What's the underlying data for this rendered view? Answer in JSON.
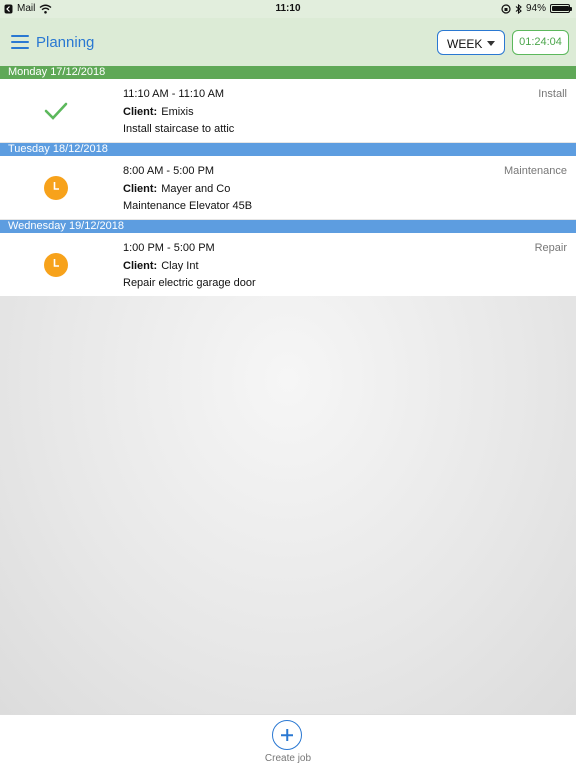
{
  "status_bar": {
    "back_app": "Mail",
    "time": "11:10",
    "battery": "94%",
    "battery_level": 0.94
  },
  "header": {
    "title": "Planning",
    "view_select": "WEEK",
    "timer": "01:24:04"
  },
  "days": [
    {
      "label": "Monday 17/12/2018",
      "color": "#5fa857",
      "jobs": [
        {
          "time": "11:10 AM - 11:10 AM",
          "type": "Install",
          "client_label": "Client:",
          "client": "Emixis",
          "description": "Install staircase to attic",
          "status_icon": "check-icon"
        }
      ]
    },
    {
      "label": "Tuesday 18/12/2018",
      "color": "#5d9de0",
      "jobs": [
        {
          "time": "8:00 AM - 5:00 PM",
          "type": "Maintenance",
          "client_label": "Client:",
          "client": "Mayer and Co",
          "description": "Maintenance Elevator 45B",
          "status_icon": "clock-icon"
        }
      ]
    },
    {
      "label": "Wednesday 19/12/2018",
      "color": "#5d9de0",
      "jobs": [
        {
          "time": "1:00 PM - 5:00 PM",
          "type": "Repair",
          "client_label": "Client:",
          "client": "Clay Int",
          "description": "Repair electric garage door",
          "status_icon": "clock-icon"
        }
      ]
    }
  ],
  "bottom": {
    "create_label": "Create job"
  },
  "colors": {
    "accent": "#2a78d2",
    "success": "#5cb85c",
    "pending": "#f7a21b"
  }
}
